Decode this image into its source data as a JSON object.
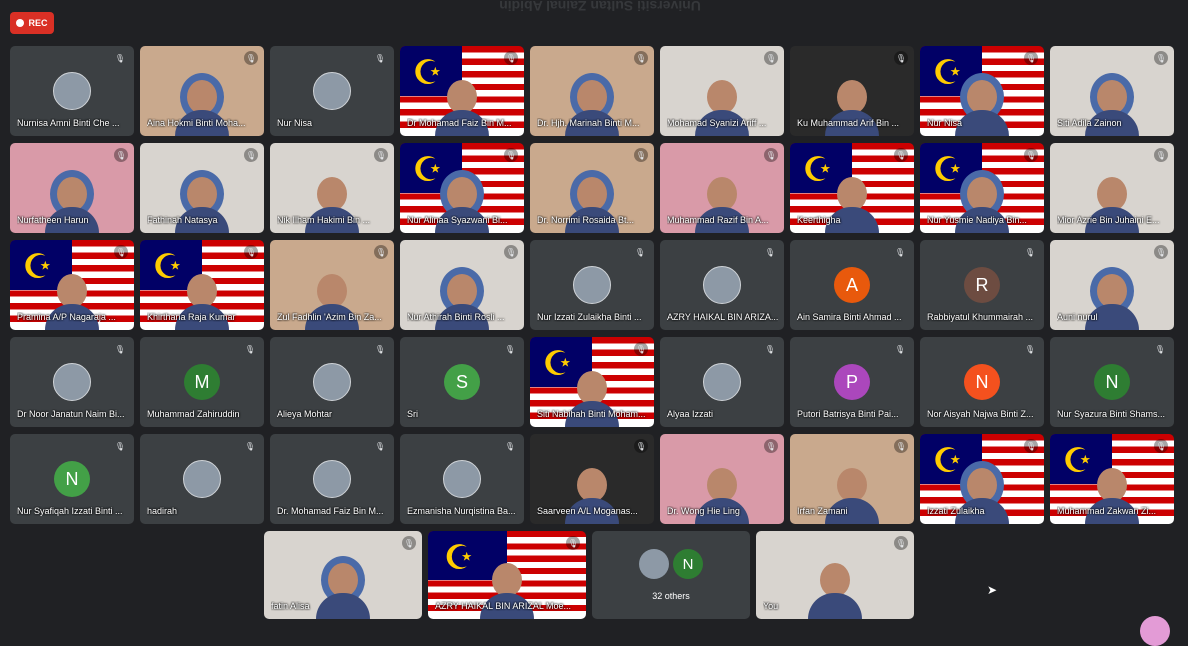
{
  "recording": {
    "label": "REC"
  },
  "banner_text": "Universiti Sultan Zainal Abidin",
  "avatar_colors": {
    "A": "#e8590c",
    "R": "#6d4c41",
    "M": "#2e7d32",
    "S": "#43a047",
    "P": "#ab47bc",
    "N_orange": "#f4511e",
    "N_green": "#2e7d32"
  },
  "participants": [
    {
      "name": "Nurnisa Amni Binti Che ...",
      "kind": "photo"
    },
    {
      "name": "Aina Hokmi Binti Moha...",
      "kind": "video",
      "style": "warm",
      "hijab": true
    },
    {
      "name": "Nur Nisa",
      "kind": "photo"
    },
    {
      "name": "Dr Mohamad Faiz Bin M...",
      "kind": "video",
      "style": "flag"
    },
    {
      "name": "Dr. Hjh. Marinah Binti M...",
      "kind": "video",
      "style": "warm",
      "hijab": true
    },
    {
      "name": "Mohamad Syanizi Ariff ...",
      "kind": "video",
      "style": "light"
    },
    {
      "name": "Ku Muhammad Arif Bin ...",
      "kind": "video",
      "style": "dark"
    },
    {
      "name": "Nur Nisa",
      "kind": "video",
      "style": "flag",
      "hijab": true
    },
    {
      "name": "Siti Adila Zainon",
      "kind": "video",
      "style": "light",
      "hijab": true
    },
    {
      "name": "Nurfatheen Harun",
      "kind": "video",
      "style": "pink",
      "hijab": true
    },
    {
      "name": "Fathinah Natasya",
      "kind": "video",
      "style": "light",
      "hijab": true
    },
    {
      "name": "Nik Ilham Hakimi Bin ...",
      "kind": "video",
      "style": "light"
    },
    {
      "name": "Nur Alinaa Syazwani Bi...",
      "kind": "video",
      "style": "flag",
      "hijab": true
    },
    {
      "name": "Dr. Norrimi Rosaida Bt...",
      "kind": "video",
      "style": "warm",
      "hijab": true
    },
    {
      "name": "Muhammad Razif Bin A...",
      "kind": "video",
      "style": "pink"
    },
    {
      "name": "Keerthigha",
      "kind": "video",
      "style": "flag"
    },
    {
      "name": "Nur Yusmie Nadiya Bin...",
      "kind": "video",
      "style": "flag",
      "hijab": true
    },
    {
      "name": "Mior Azrie Bin Juhaini E...",
      "kind": "video",
      "style": "light"
    },
    {
      "name": "Pramina A/P Nagaraja ...",
      "kind": "video",
      "style": "flag"
    },
    {
      "name": "Khirthana Raja Kumar",
      "kind": "video",
      "style": "flag"
    },
    {
      "name": "Zul Fadhlin 'Azim Bin Za...",
      "kind": "video",
      "style": "warm"
    },
    {
      "name": "Nur Athirah Binti Rosli ...",
      "kind": "video",
      "style": "light",
      "hijab": true
    },
    {
      "name": "Nur Izzati Zulaikha Binti ...",
      "kind": "photo"
    },
    {
      "name": "AZRY HAIKAL BIN ARIZA...",
      "kind": "photo"
    },
    {
      "name": "Ain Samira Binti Ahmad ...",
      "kind": "letter",
      "letter": "A",
      "color": "#e8590c"
    },
    {
      "name": "Rabbiyatul Khummairah ...",
      "kind": "letter",
      "letter": "R",
      "color": "#6d4c41"
    },
    {
      "name": "Auni nurul",
      "kind": "video",
      "style": "light",
      "hijab": true
    },
    {
      "name": "Dr Noor Janatun Naim Bi...",
      "kind": "photo"
    },
    {
      "name": "Muhammad Zahiruddin",
      "kind": "letter",
      "letter": "M",
      "color": "#2e7d32"
    },
    {
      "name": "Alieya Mohtar",
      "kind": "photo"
    },
    {
      "name": "Sri",
      "kind": "letter",
      "letter": "S",
      "color": "#43a047"
    },
    {
      "name": "Siti Nabihah Binti Moham...",
      "kind": "video",
      "style": "flag"
    },
    {
      "name": "Alyaa Izzati",
      "kind": "photo"
    },
    {
      "name": "Putori Batrisya Binti Pai...",
      "kind": "letter",
      "letter": "P",
      "color": "#ab47bc"
    },
    {
      "name": "Nor Aisyah Najwa Binti Z...",
      "kind": "letter",
      "letter": "N",
      "color": "#f4511e"
    },
    {
      "name": "Nur Syazura Binti Shams...",
      "kind": "letter",
      "letter": "N",
      "color": "#2e7d32"
    },
    {
      "name": "Nur Syafiqah Izzati Binti ...",
      "kind": "letter",
      "letter": "N",
      "color": "#43a047"
    },
    {
      "name": "hadirah",
      "kind": "photo"
    },
    {
      "name": "Dr. Mohamad Faiz Bin M...",
      "kind": "photo"
    },
    {
      "name": "Ezmanisha Nurqistina Ba...",
      "kind": "photo"
    },
    {
      "name": "Saarveen A/L Moganas...",
      "kind": "video",
      "style": "dark"
    },
    {
      "name": "Dr. Wong Hie Ling",
      "kind": "video",
      "style": "pink"
    },
    {
      "name": "Irfan Zamani",
      "kind": "video",
      "style": "warm"
    },
    {
      "name": "Izzati Zulaikha",
      "kind": "video",
      "style": "flag",
      "hijab": true
    },
    {
      "name": "Muhammad Zakwan Zi...",
      "kind": "video",
      "style": "flag"
    }
  ],
  "bottom_row": [
    {
      "name": "fatin Alisa",
      "kind": "video",
      "style": "light",
      "hijab": true
    },
    {
      "name": "AZRY HAIKAL BIN ARIZAL Moe...",
      "kind": "video",
      "style": "flag"
    },
    {
      "name": "32 others",
      "kind": "others",
      "letter": "N",
      "color": "#2e7d32"
    },
    {
      "name": "You",
      "kind": "video",
      "style": "light"
    }
  ]
}
